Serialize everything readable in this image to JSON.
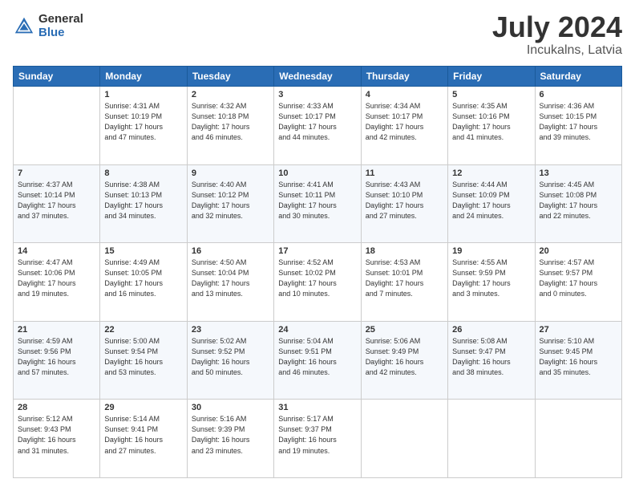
{
  "header": {
    "logo_general": "General",
    "logo_blue": "Blue",
    "title": "July 2024",
    "location": "Incukalns, Latvia"
  },
  "days_of_week": [
    "Sunday",
    "Monday",
    "Tuesday",
    "Wednesday",
    "Thursday",
    "Friday",
    "Saturday"
  ],
  "weeks": [
    [
      {
        "day": "",
        "info": ""
      },
      {
        "day": "1",
        "info": "Sunrise: 4:31 AM\nSunset: 10:19 PM\nDaylight: 17 hours\nand 47 minutes."
      },
      {
        "day": "2",
        "info": "Sunrise: 4:32 AM\nSunset: 10:18 PM\nDaylight: 17 hours\nand 46 minutes."
      },
      {
        "day": "3",
        "info": "Sunrise: 4:33 AM\nSunset: 10:17 PM\nDaylight: 17 hours\nand 44 minutes."
      },
      {
        "day": "4",
        "info": "Sunrise: 4:34 AM\nSunset: 10:17 PM\nDaylight: 17 hours\nand 42 minutes."
      },
      {
        "day": "5",
        "info": "Sunrise: 4:35 AM\nSunset: 10:16 PM\nDaylight: 17 hours\nand 41 minutes."
      },
      {
        "day": "6",
        "info": "Sunrise: 4:36 AM\nSunset: 10:15 PM\nDaylight: 17 hours\nand 39 minutes."
      }
    ],
    [
      {
        "day": "7",
        "info": "Sunrise: 4:37 AM\nSunset: 10:14 PM\nDaylight: 17 hours\nand 37 minutes."
      },
      {
        "day": "8",
        "info": "Sunrise: 4:38 AM\nSunset: 10:13 PM\nDaylight: 17 hours\nand 34 minutes."
      },
      {
        "day": "9",
        "info": "Sunrise: 4:40 AM\nSunset: 10:12 PM\nDaylight: 17 hours\nand 32 minutes."
      },
      {
        "day": "10",
        "info": "Sunrise: 4:41 AM\nSunset: 10:11 PM\nDaylight: 17 hours\nand 30 minutes."
      },
      {
        "day": "11",
        "info": "Sunrise: 4:43 AM\nSunset: 10:10 PM\nDaylight: 17 hours\nand 27 minutes."
      },
      {
        "day": "12",
        "info": "Sunrise: 4:44 AM\nSunset: 10:09 PM\nDaylight: 17 hours\nand 24 minutes."
      },
      {
        "day": "13",
        "info": "Sunrise: 4:45 AM\nSunset: 10:08 PM\nDaylight: 17 hours\nand 22 minutes."
      }
    ],
    [
      {
        "day": "14",
        "info": "Sunrise: 4:47 AM\nSunset: 10:06 PM\nDaylight: 17 hours\nand 19 minutes."
      },
      {
        "day": "15",
        "info": "Sunrise: 4:49 AM\nSunset: 10:05 PM\nDaylight: 17 hours\nand 16 minutes."
      },
      {
        "day": "16",
        "info": "Sunrise: 4:50 AM\nSunset: 10:04 PM\nDaylight: 17 hours\nand 13 minutes."
      },
      {
        "day": "17",
        "info": "Sunrise: 4:52 AM\nSunset: 10:02 PM\nDaylight: 17 hours\nand 10 minutes."
      },
      {
        "day": "18",
        "info": "Sunrise: 4:53 AM\nSunset: 10:01 PM\nDaylight: 17 hours\nand 7 minutes."
      },
      {
        "day": "19",
        "info": "Sunrise: 4:55 AM\nSunset: 9:59 PM\nDaylight: 17 hours\nand 3 minutes."
      },
      {
        "day": "20",
        "info": "Sunrise: 4:57 AM\nSunset: 9:57 PM\nDaylight: 17 hours\nand 0 minutes."
      }
    ],
    [
      {
        "day": "21",
        "info": "Sunrise: 4:59 AM\nSunset: 9:56 PM\nDaylight: 16 hours\nand 57 minutes."
      },
      {
        "day": "22",
        "info": "Sunrise: 5:00 AM\nSunset: 9:54 PM\nDaylight: 16 hours\nand 53 minutes."
      },
      {
        "day": "23",
        "info": "Sunrise: 5:02 AM\nSunset: 9:52 PM\nDaylight: 16 hours\nand 50 minutes."
      },
      {
        "day": "24",
        "info": "Sunrise: 5:04 AM\nSunset: 9:51 PM\nDaylight: 16 hours\nand 46 minutes."
      },
      {
        "day": "25",
        "info": "Sunrise: 5:06 AM\nSunset: 9:49 PM\nDaylight: 16 hours\nand 42 minutes."
      },
      {
        "day": "26",
        "info": "Sunrise: 5:08 AM\nSunset: 9:47 PM\nDaylight: 16 hours\nand 38 minutes."
      },
      {
        "day": "27",
        "info": "Sunrise: 5:10 AM\nSunset: 9:45 PM\nDaylight: 16 hours\nand 35 minutes."
      }
    ],
    [
      {
        "day": "28",
        "info": "Sunrise: 5:12 AM\nSunset: 9:43 PM\nDaylight: 16 hours\nand 31 minutes."
      },
      {
        "day": "29",
        "info": "Sunrise: 5:14 AM\nSunset: 9:41 PM\nDaylight: 16 hours\nand 27 minutes."
      },
      {
        "day": "30",
        "info": "Sunrise: 5:16 AM\nSunset: 9:39 PM\nDaylight: 16 hours\nand 23 minutes."
      },
      {
        "day": "31",
        "info": "Sunrise: 5:17 AM\nSunset: 9:37 PM\nDaylight: 16 hours\nand 19 minutes."
      },
      {
        "day": "",
        "info": ""
      },
      {
        "day": "",
        "info": ""
      },
      {
        "day": "",
        "info": ""
      }
    ]
  ]
}
